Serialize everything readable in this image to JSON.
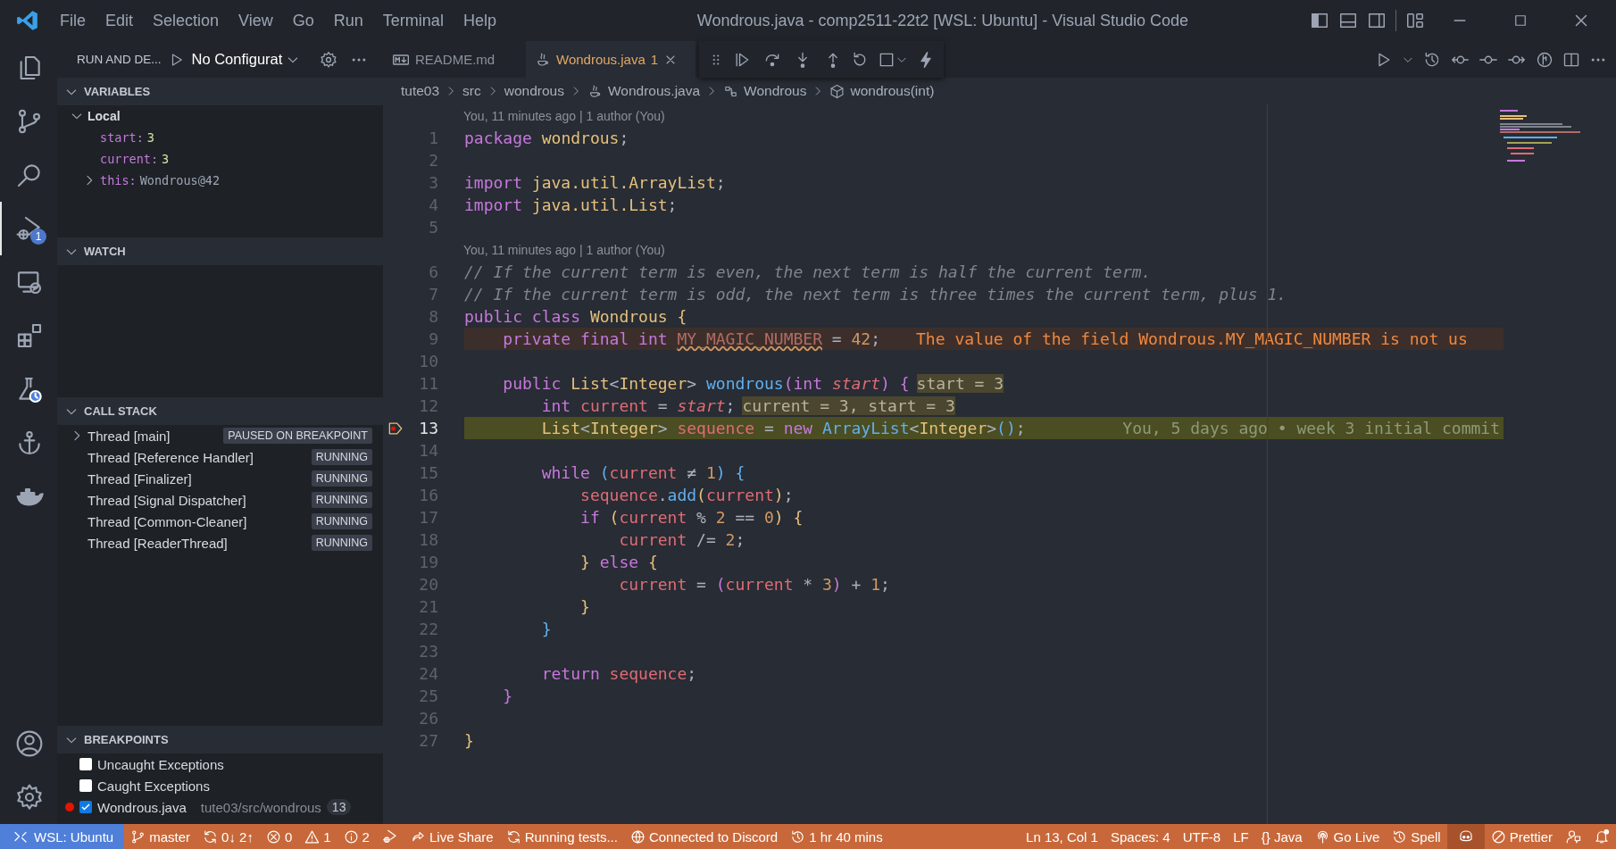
{
  "window": {
    "title": "Wondrous.java - comp2511-22t2 [WSL: Ubuntu] - Visual Studio Code"
  },
  "menu": [
    "File",
    "Edit",
    "Selection",
    "View",
    "Go",
    "Run",
    "Terminal",
    "Help"
  ],
  "activity_bar": [
    {
      "selected": false
    },
    {
      "selected": false
    },
    {
      "selected": false
    },
    {
      "selected": true,
      "badge": "1"
    },
    {
      "selected": false
    },
    {
      "selected": false
    },
    {
      "selected": false
    },
    {
      "selected": false
    },
    {
      "selected": false
    },
    {
      "selected": false
    },
    {
      "selected": false
    }
  ],
  "sidebar": {
    "title": "RUN AND DE...",
    "configuration": "No Configurat",
    "sections": [
      {
        "title": "VARIABLES",
        "expanded": true
      },
      {
        "title": "WATCH",
        "expanded": true
      },
      {
        "title": "CALL STACK",
        "expanded": true
      },
      {
        "title": "BREAKPOINTS",
        "expanded": true
      }
    ],
    "variables": [
      {
        "kind": "scope",
        "name": "Local",
        "expanded": true,
        "children": [
          {
            "kind": "value",
            "name": "start:",
            "value": "3"
          },
          {
            "kind": "value",
            "name": "current:",
            "value": "3"
          },
          {
            "kind": "object",
            "name": "this:",
            "value": "Wondrous@42",
            "expanded": false
          }
        ]
      }
    ],
    "threads": [
      {
        "kind": "expandable",
        "name": "Thread [main]",
        "status": "PAUSED ON BREAKPOINT",
        "expanded": false
      },
      {
        "kind": "leaf",
        "name": "Thread [Reference Handler]",
        "status": "RUNNING"
      },
      {
        "kind": "leaf",
        "name": "Thread [Finalizer]",
        "status": "RUNNING"
      },
      {
        "kind": "leaf",
        "name": "Thread [Signal Dispatcher]",
        "status": "RUNNING"
      },
      {
        "kind": "leaf",
        "name": "Thread [Common-Cleaner]",
        "status": "RUNNING"
      },
      {
        "kind": "leaf",
        "name": "Thread [ReaderThread]",
        "status": "RUNNING"
      }
    ],
    "breakpoints": [
      {
        "kind": "exception",
        "label": "Uncaught Exceptions",
        "checked": false
      },
      {
        "kind": "exception",
        "label": "Caught Exceptions",
        "checked": false
      },
      {
        "kind": "file",
        "label": "Wondrous.java",
        "path": "tute03/src/wondrous",
        "line": "13",
        "checked": true
      }
    ]
  },
  "tabs": [
    {
      "kind": "markdown",
      "label": "README.md",
      "selected": false
    },
    {
      "kind": "java",
      "label": "Wondrous.java",
      "problems": "1",
      "selected": true
    }
  ],
  "breadcrumbs": [
    {
      "kind": "folder",
      "label": "tute03"
    },
    {
      "kind": "folder",
      "label": "src"
    },
    {
      "kind": "folder",
      "label": "wondrous"
    },
    {
      "kind": "java",
      "label": "Wondrous.java"
    },
    {
      "kind": "class",
      "label": "Wondrous"
    },
    {
      "kind": "method",
      "label": "wondrous(int)"
    }
  ],
  "code": [
    {
      "number": "1",
      "paused": false,
      "lens": "You, 11 minutes ago | 1 author (You)",
      "tokens": [
        {
          "kind": "kw",
          "t": "package "
        },
        {
          "kind": "type",
          "t": "wondrous"
        },
        {
          "kind": "p",
          "t": ";"
        }
      ]
    },
    {
      "number": "2",
      "paused": false
    },
    {
      "number": "3",
      "paused": false,
      "tokens": [
        {
          "kind": "kw",
          "t": "import "
        },
        {
          "kind": "type",
          "t": "java.util.ArrayList"
        },
        {
          "kind": "p",
          "t": ";"
        }
      ]
    },
    {
      "number": "4",
      "paused": false,
      "tokens": [
        {
          "kind": "kw",
          "t": "import "
        },
        {
          "kind": "type",
          "t": "java.util.List"
        },
        {
          "kind": "p",
          "t": ";"
        }
      ]
    },
    {
      "number": "5",
      "paused": false
    },
    {
      "number": "6",
      "paused": false,
      "lens": "You, 11 minutes ago | 1 author (You)",
      "tokens": [
        {
          "kind": "comment",
          "t": "// If the current term is even, the next term is half the current term."
        }
      ]
    },
    {
      "number": "7",
      "paused": false,
      "tokens": [
        {
          "kind": "comment",
          "t": "// If the current term is odd, the next term is three times the current term, plus 1."
        }
      ]
    },
    {
      "number": "8",
      "paused": false,
      "tokens": [
        {
          "kind": "kw",
          "t": "public class "
        },
        {
          "kind": "type",
          "t": "Wondrous "
        },
        {
          "kind": "b1",
          "t": "{"
        }
      ]
    },
    {
      "number": "9",
      "paused": false,
      "kind": "warning",
      "message": "The value of the field Wondrous.MY_MAGIC_NUMBER is not us",
      "tokens": [
        {
          "kind": "kw",
          "t": "    private final int "
        },
        {
          "kind": "unused",
          "t": "MY_MAGIC_NUMBER"
        },
        {
          "kind": "p",
          "t": " = "
        },
        {
          "kind": "num",
          "t": "42"
        },
        {
          "kind": "p",
          "t": ";"
        }
      ]
    },
    {
      "number": "10",
      "paused": false
    },
    {
      "number": "11",
      "paused": false,
      "inline": "start = 3",
      "tokens": [
        {
          "kind": "kw",
          "t": "    public "
        },
        {
          "kind": "type",
          "t": "List"
        },
        {
          "kind": "p",
          "t": "<"
        },
        {
          "kind": "type",
          "t": "Integer"
        },
        {
          "kind": "p",
          "t": "> "
        },
        {
          "kind": "fn",
          "t": "wondrous"
        },
        {
          "kind": "b2",
          "t": "("
        },
        {
          "kind": "kw",
          "t": "int "
        },
        {
          "kind": "param",
          "t": "start"
        },
        {
          "kind": "b2",
          "t": ") {"
        }
      ]
    },
    {
      "number": "12",
      "paused": false,
      "inline": "current = 3, start = 3",
      "tokens": [
        {
          "kind": "kw",
          "t": "        int "
        },
        {
          "kind": "var",
          "t": "current"
        },
        {
          "kind": "p",
          "t": " = "
        },
        {
          "kind": "param",
          "t": "start"
        },
        {
          "kind": "p",
          "t": ";"
        }
      ]
    },
    {
      "number": "13",
      "paused": true,
      "kind": "current",
      "ghost": "You, 5 days ago • week 3 initial commit",
      "tokens": [
        {
          "kind": "type",
          "t": "        List"
        },
        {
          "kind": "p",
          "t": "<"
        },
        {
          "kind": "type",
          "t": "Integer"
        },
        {
          "kind": "p",
          "t": "> "
        },
        {
          "kind": "var",
          "t": "sequence"
        },
        {
          "kind": "p",
          "t": " = "
        },
        {
          "kind": "kw",
          "t": "new "
        },
        {
          "kind": "fn",
          "t": "ArrayList"
        },
        {
          "kind": "p",
          "t": "<"
        },
        {
          "kind": "type",
          "t": "Integer"
        },
        {
          "kind": "p",
          "t": ">"
        },
        {
          "kind": "b3",
          "t": "()"
        },
        {
          "kind": "p",
          "t": ";"
        }
      ]
    },
    {
      "number": "14",
      "paused": false
    },
    {
      "number": "15",
      "paused": false,
      "tokens": [
        {
          "kind": "kw",
          "t": "        while "
        },
        {
          "kind": "b3",
          "t": "("
        },
        {
          "kind": "var",
          "t": "current"
        },
        {
          "kind": "p",
          "t": " ≠ "
        },
        {
          "kind": "num",
          "t": "1"
        },
        {
          "kind": "b3",
          "t": ") {"
        }
      ]
    },
    {
      "number": "16",
      "paused": false,
      "tokens": [
        {
          "kind": "var",
          "t": "            sequence"
        },
        {
          "kind": "p",
          "t": "."
        },
        {
          "kind": "fn",
          "t": "add"
        },
        {
          "kind": "b1",
          "t": "("
        },
        {
          "kind": "var",
          "t": "current"
        },
        {
          "kind": "b1",
          "t": ")"
        },
        {
          "kind": "p",
          "t": ";"
        }
      ]
    },
    {
      "number": "17",
      "paused": false,
      "tokens": [
        {
          "kind": "kw",
          "t": "            if "
        },
        {
          "kind": "b1",
          "t": "("
        },
        {
          "kind": "var",
          "t": "current"
        },
        {
          "kind": "p",
          "t": " % "
        },
        {
          "kind": "num",
          "t": "2"
        },
        {
          "kind": "p",
          "t": " == "
        },
        {
          "kind": "num",
          "t": "0"
        },
        {
          "kind": "b1",
          "t": ") {"
        }
      ]
    },
    {
      "number": "18",
      "paused": false,
      "tokens": [
        {
          "kind": "var",
          "t": "                current"
        },
        {
          "kind": "p",
          "t": " /= "
        },
        {
          "kind": "num",
          "t": "2"
        },
        {
          "kind": "p",
          "t": ";"
        }
      ]
    },
    {
      "number": "19",
      "paused": false,
      "tokens": [
        {
          "kind": "b1",
          "t": "            } "
        },
        {
          "kind": "kw",
          "t": "else "
        },
        {
          "kind": "b1",
          "t": "{"
        }
      ]
    },
    {
      "number": "20",
      "paused": false,
      "tokens": [
        {
          "kind": "var",
          "t": "                current"
        },
        {
          "kind": "p",
          "t": " = "
        },
        {
          "kind": "b2",
          "t": "("
        },
        {
          "kind": "var",
          "t": "current"
        },
        {
          "kind": "p",
          "t": " * "
        },
        {
          "kind": "num",
          "t": "3"
        },
        {
          "kind": "b2",
          "t": ")"
        },
        {
          "kind": "p",
          "t": " + "
        },
        {
          "kind": "num",
          "t": "1"
        },
        {
          "kind": "p",
          "t": ";"
        }
      ]
    },
    {
      "number": "21",
      "paused": false,
      "tokens": [
        {
          "kind": "b1",
          "t": "            }"
        }
      ]
    },
    {
      "number": "22",
      "paused": false,
      "tokens": [
        {
          "kind": "b3",
          "t": "        }"
        }
      ]
    },
    {
      "number": "23",
      "paused": false
    },
    {
      "number": "24",
      "paused": false,
      "tokens": [
        {
          "kind": "kw",
          "t": "        return "
        },
        {
          "kind": "var",
          "t": "sequence"
        },
        {
          "kind": "p",
          "t": ";"
        }
      ]
    },
    {
      "number": "25",
      "paused": false,
      "tokens": [
        {
          "kind": "b2",
          "t": "    }"
        }
      ]
    },
    {
      "number": "26",
      "paused": false
    },
    {
      "number": "27",
      "paused": false,
      "tokens": [
        {
          "kind": "b1",
          "t": "}"
        }
      ]
    }
  ],
  "status_bar": {
    "remote": "WSL: Ubuntu",
    "left": [
      {
        "kind": "branch",
        "text": "master"
      },
      {
        "kind": "sync",
        "text": "0↓ 2↑"
      },
      {
        "kind": "errors",
        "text": "0"
      },
      {
        "kind": "warnings",
        "text": "1"
      },
      {
        "kind": "info",
        "text": "2"
      },
      {
        "kind": "debug"
      },
      {
        "kind": "share",
        "text": "Live Share"
      },
      {
        "kind": "sync",
        "text": "Running tests..."
      },
      {
        "kind": "globe",
        "text": "Connected to Discord"
      },
      {
        "kind": "history",
        "text": "1 hr 40 mins"
      }
    ],
    "right": [
      {
        "kind": "text",
        "text": "Ln 13, Col 1"
      },
      {
        "kind": "text",
        "text": "Spaces: 4"
      },
      {
        "kind": "text",
        "text": "UTF-8"
      },
      {
        "kind": "text",
        "text": "LF"
      },
      {
        "kind": "text",
        "text": "{} Java"
      },
      {
        "kind": "broadcast",
        "text": "Go Live"
      },
      {
        "kind": "history",
        "text": "Spell"
      },
      {
        "kind": "copilot"
      },
      {
        "kind": "blocked",
        "text": "Prettier"
      },
      {
        "kind": "feedback"
      },
      {
        "kind": "bell"
      }
    ]
  }
}
